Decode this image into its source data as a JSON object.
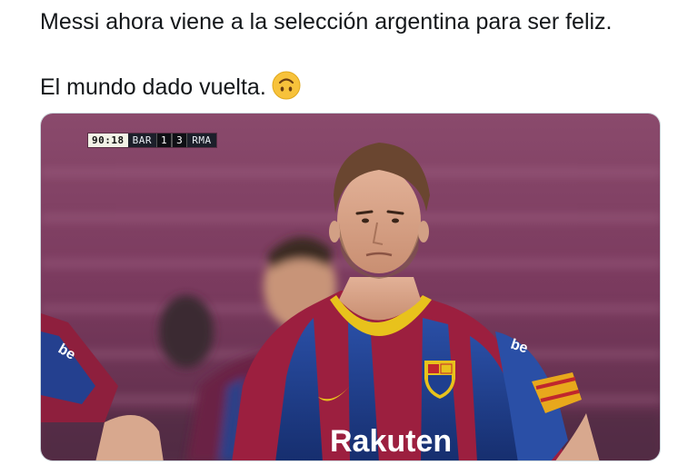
{
  "tweet": {
    "line1": "Messi ahora viene a la selección argentina para ser feliz.",
    "line2": "El mundo dado vuelta.",
    "emoji": "upside-down-face-emoji"
  },
  "media": {
    "scoreboard": {
      "clock": "90:18",
      "home_team": "BAR",
      "home_score": "1",
      "away_score": "3",
      "away_team": "RMA"
    },
    "jersey": {
      "sponsor": "Rakuten",
      "sleeve": "be"
    }
  },
  "colors": {
    "text": "#14171a",
    "media_border": "#cfd9de",
    "stand_magenta": "#7d3a5f",
    "barca_blue": "#1f3f8f",
    "barca_garnet": "#9c1f3f",
    "collar_yellow": "#e8c21c"
  }
}
